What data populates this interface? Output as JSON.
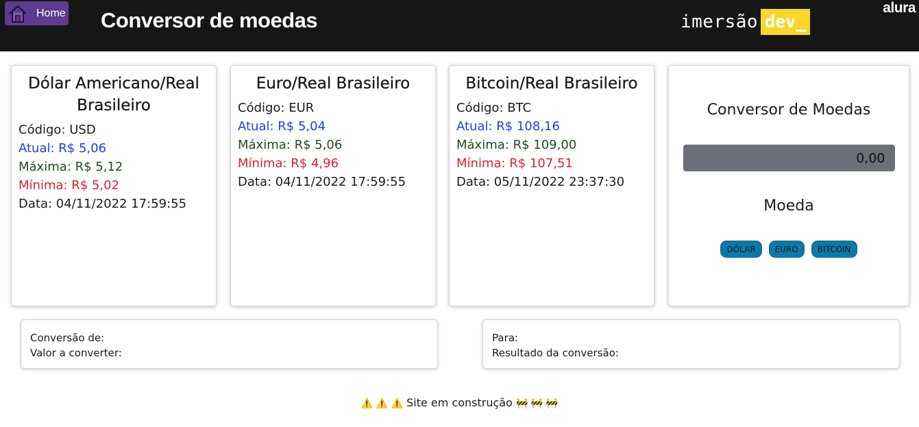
{
  "header": {
    "home_label": "Home",
    "title": "Conversor de moedas",
    "brand_text": "imersão",
    "brand_dev": "dev_",
    "alura": "alura"
  },
  "cards": [
    {
      "title": "Dólar Americano/Real Brasileiro",
      "codigo": "Código: USD",
      "atual": "Atual: R$ 5,06",
      "maxima": "Máxima: R$ 5,12",
      "minima": "Mínima: R$ 5,02",
      "data": "Data: 04/11/2022 17:59:55"
    },
    {
      "title": "Euro/Real Brasileiro",
      "codigo": "Código: EUR",
      "atual": "Atual: R$ 5,04",
      "maxima": "Máxima: R$ 5,06",
      "minima": "Mínima: R$ 4,96",
      "data": "Data: 04/11/2022 17:59:55"
    },
    {
      "title": "Bitcoin/Real Brasileiro",
      "codigo": "Código: BTC",
      "atual": "Atual: R$ 108,16",
      "maxima": "Máxima: R$ 109,00",
      "minima": "Mínima: R$ 107,51",
      "data": "Data: 05/11/2022 23:37:30"
    }
  ],
  "converter": {
    "title": "Conversor de Moedas",
    "amount_value": "0,00",
    "moeda_label": "Moeda",
    "buttons": [
      "DÓLAR",
      "EURO",
      "BITCOIN"
    ]
  },
  "results": {
    "conversao_de": "Conversão de:",
    "valor_a_converter": "Valor a converter:",
    "para": "Para:",
    "resultado": "Resultado da conversão:"
  },
  "footer": {
    "warning_icons": "⚠️ ⚠️ ⚠️",
    "text": "Site em construção",
    "construction_icons": "🚧 🚧 🚧"
  },
  "colors": {
    "header_bg": "#161616",
    "home_btn": "#5e3a91",
    "brand_accent": "#f5d82a",
    "atual": "#1f3fe0",
    "maxima": "#1e4a1e",
    "minima": "#e0202e",
    "currency_button": "#0c7aa6"
  }
}
